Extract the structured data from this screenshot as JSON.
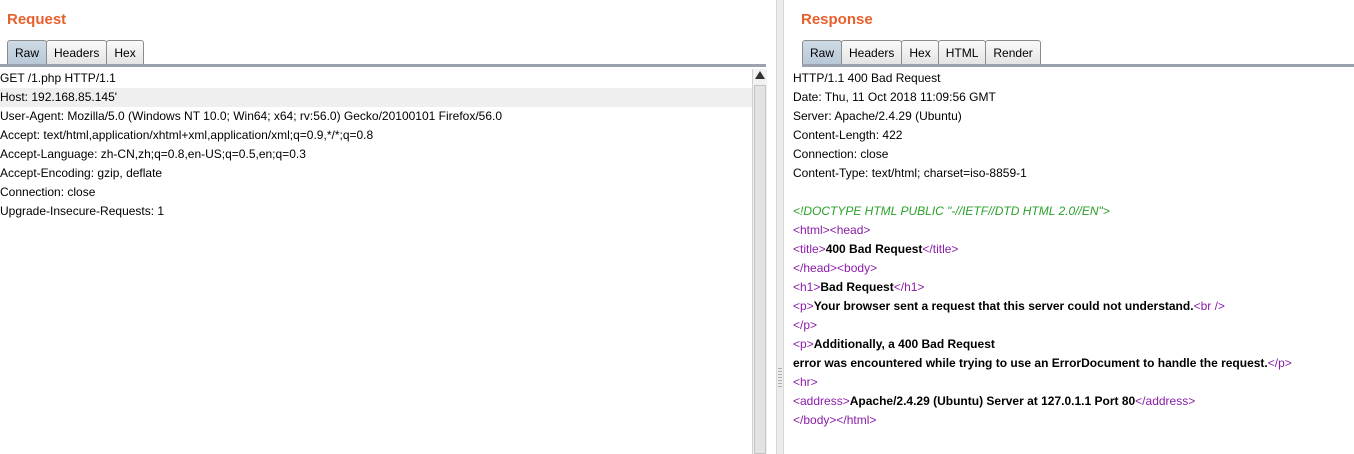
{
  "request": {
    "title": "Request",
    "tabs": [
      "Raw",
      "Headers",
      "Hex"
    ],
    "active_tab": "Raw",
    "lines": [
      "GET /1.php HTTP/1.1",
      "Host: 192.168.85.145'",
      "User-Agent: Mozilla/5.0 (Windows NT 10.0; Win64; x64; rv:56.0) Gecko/20100101 Firefox/56.0",
      "Accept: text/html,application/xhtml+xml,application/xml;q=0.9,*/*;q=0.8",
      "Accept-Language: zh-CN,zh;q=0.8,en-US;q=0.5,en;q=0.3",
      "Accept-Encoding: gzip, deflate",
      "Connection: close",
      "Upgrade-Insecure-Requests: 1"
    ]
  },
  "response": {
    "title": "Response",
    "tabs": [
      "Raw",
      "Headers",
      "Hex",
      "HTML",
      "Render"
    ],
    "active_tab": "Raw",
    "headers": [
      "HTTP/1.1 400 Bad Request",
      "Date: Thu, 11 Oct 2018 11:09:56 GMT",
      "Server: Apache/2.4.29 (Ubuntu)",
      "Content-Length: 422",
      "Connection: close",
      "Content-Type: text/html; charset=iso-8859-1"
    ],
    "body": {
      "doctype": "<!DOCTYPE HTML PUBLIC \"-//IETF//DTD HTML 2.0//EN\">",
      "tag_html_open": "<html>",
      "tag_head_open": "<head>",
      "tag_title_open": "<title>",
      "title_text": "400 Bad Request",
      "tag_title_close": "</title>",
      "tag_head_close": "</head>",
      "tag_body_open": "<body>",
      "tag_h1_open": "<h1>",
      "h1_text": "Bad Request",
      "tag_h1_close": "</h1>",
      "tag_p_open": "<p>",
      "p1_text": "Your browser sent a request that this server could not understand.",
      "tag_br": "<br />",
      "tag_p_close": "</p>",
      "p2_text_1": "Additionally, a 400 Bad Request",
      "p2_text_2": "error was encountered while trying to use an ErrorDocument to handle the request.",
      "tag_hr": "<hr>",
      "tag_address_open": "<address>",
      "address_text": "Apache/2.4.29 (Ubuntu) Server at 127.0.1.1 Port 80",
      "tag_address_close": "</address>",
      "tag_body_close": "</body>",
      "tag_html_close": "</html>"
    }
  },
  "colors": {
    "title": "#e8602c",
    "tag": "#8b1ca9",
    "doctype": "#2aa12a"
  }
}
